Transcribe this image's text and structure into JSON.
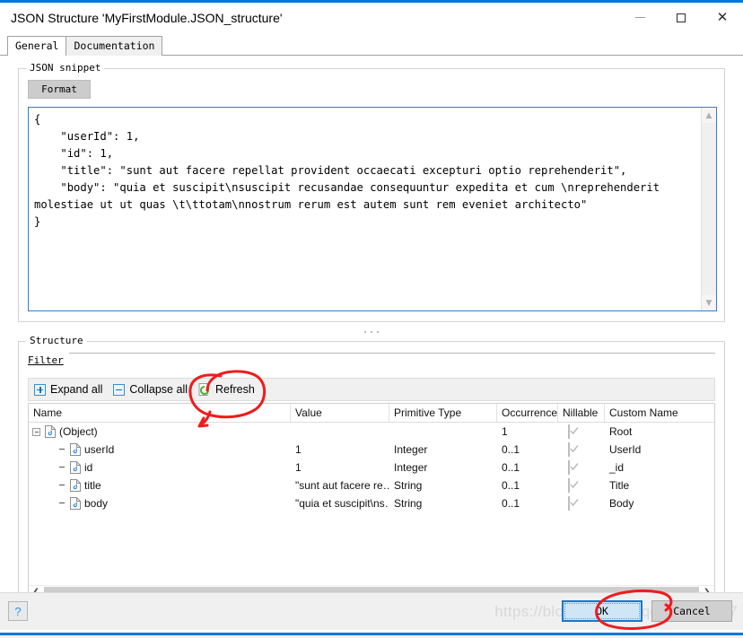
{
  "window": {
    "title": "JSON Structure 'MyFirstModule.JSON_structure'",
    "controls": {
      "minimize": "—",
      "maximize": "□",
      "close": "✕"
    }
  },
  "tabs": [
    {
      "label": "General",
      "active": true
    },
    {
      "label": "Documentation",
      "active": false
    }
  ],
  "json_snippet": {
    "group_title": "JSON snippet",
    "format_label": "Format",
    "code": "{\n    \"userId\": 1,\n    \"id\": 1,\n    \"title\": \"sunt aut facere repellat provident occaecati excepturi optio reprehenderit\",\n    \"body\": \"quia et suscipit\\nsuscipit recusandae consequuntur expedita et cum \\nreprehenderit molestiae ut ut quas \\t\\ttotam\\nnostrum rerum est autem sunt rem eveniet architecto\"\n}"
  },
  "structure": {
    "group_title": "Structure",
    "filter_label": "Filter",
    "filter_value": "",
    "filter_placeholder": "",
    "toolbar": {
      "expand_all": "Expand all",
      "collapse_all": "Collapse all",
      "refresh": "Refresh"
    },
    "columns": [
      "Name",
      "Value",
      "Primitive Type",
      "Occurrence",
      "Nillable",
      "Custom Name"
    ],
    "rows": [
      {
        "name": "(Object)",
        "value": "",
        "type": "",
        "occurrence": "1",
        "nillable": true,
        "custom": "Root",
        "level": 0,
        "expander": "minus"
      },
      {
        "name": "userId",
        "value": "1",
        "type": "Integer",
        "occurrence": "0..1",
        "nillable": true,
        "custom": "UserId",
        "level": 1,
        "expander": "none"
      },
      {
        "name": "id",
        "value": "1",
        "type": "Integer",
        "occurrence": "0..1",
        "nillable": true,
        "custom": "_id",
        "level": 1,
        "expander": "none"
      },
      {
        "name": "title",
        "value": "\"sunt aut facere re…",
        "type": "String",
        "occurrence": "0..1",
        "nillable": true,
        "custom": "Title",
        "level": 1,
        "expander": "none"
      },
      {
        "name": "body",
        "value": "\"quia et suscipit\\ns…",
        "type": "String",
        "occurrence": "0..1",
        "nillable": true,
        "custom": "Body",
        "level": 1,
        "expander": "none"
      }
    ]
  },
  "footer": {
    "help_label": "?",
    "ok_label": "OK",
    "cancel_label": "Cancel"
  },
  "watermark": "https://blog.csdn.net/qq_39243017",
  "colors": {
    "accent": "#0078d7",
    "code_border": "#2f7fd1",
    "ok_border": "#1477d1",
    "annotation": "#ee1c1c",
    "icon_blue": "#3a8fd0"
  }
}
